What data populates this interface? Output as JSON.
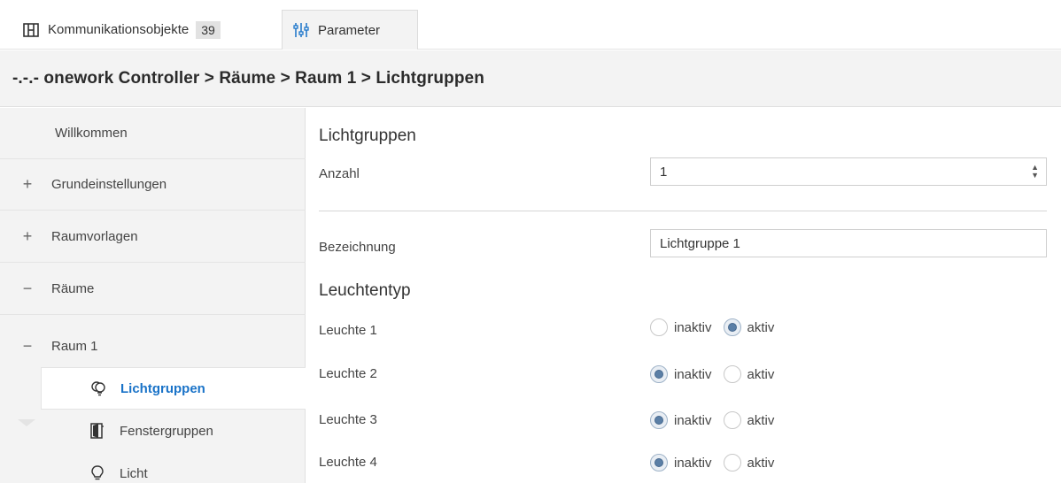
{
  "tabs": [
    {
      "label": "Kommunikationsobjekte",
      "badge": "39",
      "icon": "communication-objects-icon",
      "active": false
    },
    {
      "label": "Parameter",
      "icon": "sliders-icon",
      "active": true
    }
  ],
  "breadcrumb": "-.-.- onework Controller > Räume > Raum 1 > Lichtgruppen",
  "sidebar": {
    "items": [
      {
        "label": "Willkommen",
        "sign": ""
      },
      {
        "label": "Grundeinstellungen",
        "sign": "+"
      },
      {
        "label": "Raumvorlagen",
        "sign": "+"
      },
      {
        "label": "Räume",
        "sign": "−"
      },
      {
        "label": "Raum 1",
        "sign": "−"
      }
    ],
    "subitems": [
      {
        "label": "Lichtgruppen",
        "icon": "light-group-icon",
        "active": true
      },
      {
        "label": "Fenstergruppen",
        "icon": "window-group-icon",
        "active": false
      },
      {
        "label": "Licht",
        "icon": "bulb-icon",
        "active": false
      }
    ]
  },
  "main": {
    "section1_title": "Lichtgruppen",
    "anzahl_label": "Anzahl",
    "anzahl_value": "1",
    "bezeichnung_label": "Bezeichnung",
    "bezeichnung_value": "Lichtgruppe 1",
    "section2_title": "Leuchtentyp",
    "option_inactive": "inaktiv",
    "option_active": "aktiv",
    "leuchten": [
      {
        "label": "Leuchte 1",
        "value": "aktiv"
      },
      {
        "label": "Leuchte 2",
        "value": "inaktiv"
      },
      {
        "label": "Leuchte 3",
        "value": "inaktiv"
      },
      {
        "label": "Leuchte 4",
        "value": "inaktiv"
      }
    ]
  },
  "colors": {
    "accent": "#1a73c8",
    "radio_fill": "#5b7fa6",
    "panel_bg": "#f3f3f3"
  }
}
